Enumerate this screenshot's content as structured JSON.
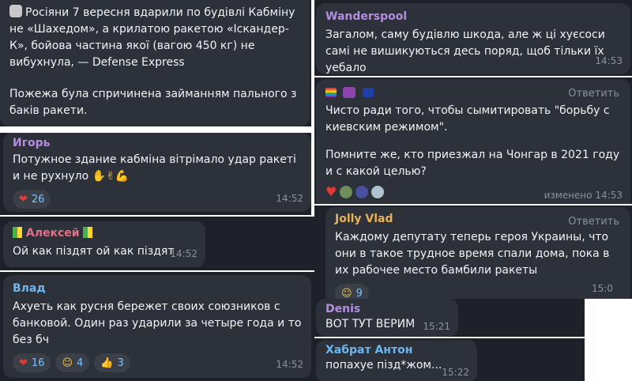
{
  "msg1": {
    "text1": "Росіяни 7 вересня вдарили по будівлі Кабміну не «Шахедом», а крилатою ракетою «Іскандер-К», бойова частина якої (вагою 450 кг) не вибухнула, — Defense Express",
    "text2": "Пожежа була спричинена займанням пального з баків ракети."
  },
  "msg2": {
    "author": "Wanderspool",
    "text": "Загалом, саму будівлю шкода, але ж ці хуєсоси самі не вишикуються десь поряд, щоб тільки їх уебало",
    "time": "14:53"
  },
  "msg3": {
    "reply": "Ответить",
    "text1": "Чисто ради того, чтобы сымитировать \"борьбу с киевским режимом\".",
    "text2": "Помните же, кто приезжал на Чонгар в 2021 году и с какой целью?",
    "time": "изменено 14:53"
  },
  "msg4": {
    "author": "Игорь",
    "text": "Потужное здание кабміна вітрімало удар ракеті и не рухнуло",
    "reaction_count": "26",
    "time": "14:52"
  },
  "msg5": {
    "author": "Алексей",
    "text": "Ой как піздят ой как піздят",
    "time": "14:52"
  },
  "msg6": {
    "author": "Влад",
    "text": "Ахуеть как русня бережет своих союзников с банковой. Один раз ударили за четыре года и то без бч",
    "reactions": [
      "16",
      "4",
      "3"
    ],
    "time": "14:52"
  },
  "msg7": {
    "author": "Jolly Vlad",
    "reply": "Ответить",
    "text": "Каждому депутату теперь героя Украины, что они в такое трудное время спали дома, пока в их рабочее место бамбили ракеты",
    "reaction_count": "9",
    "time": "15:0"
  },
  "msg8": {
    "author": "Denis",
    "text": "ВОТ ТУТ ВЕРИМ",
    "time": "15:21"
  },
  "msg9": {
    "author": "Хабрат Антон",
    "text": "попахуе пізд*жом...",
    "time": "15:22"
  },
  "colors": {
    "bubble": "#2d3139",
    "canvas": "#1e2228",
    "name_wanderspool": "#b48ee3",
    "name_igor": "#b48ee3",
    "name_alexey": "#e0708a",
    "name_vlad": "#6eb6f0",
    "name_jolly": "#e8b25a",
    "name_denis": "#b48ee3",
    "name_habrat": "#6eb6f0",
    "reaction_text": "#7bc3ff"
  }
}
